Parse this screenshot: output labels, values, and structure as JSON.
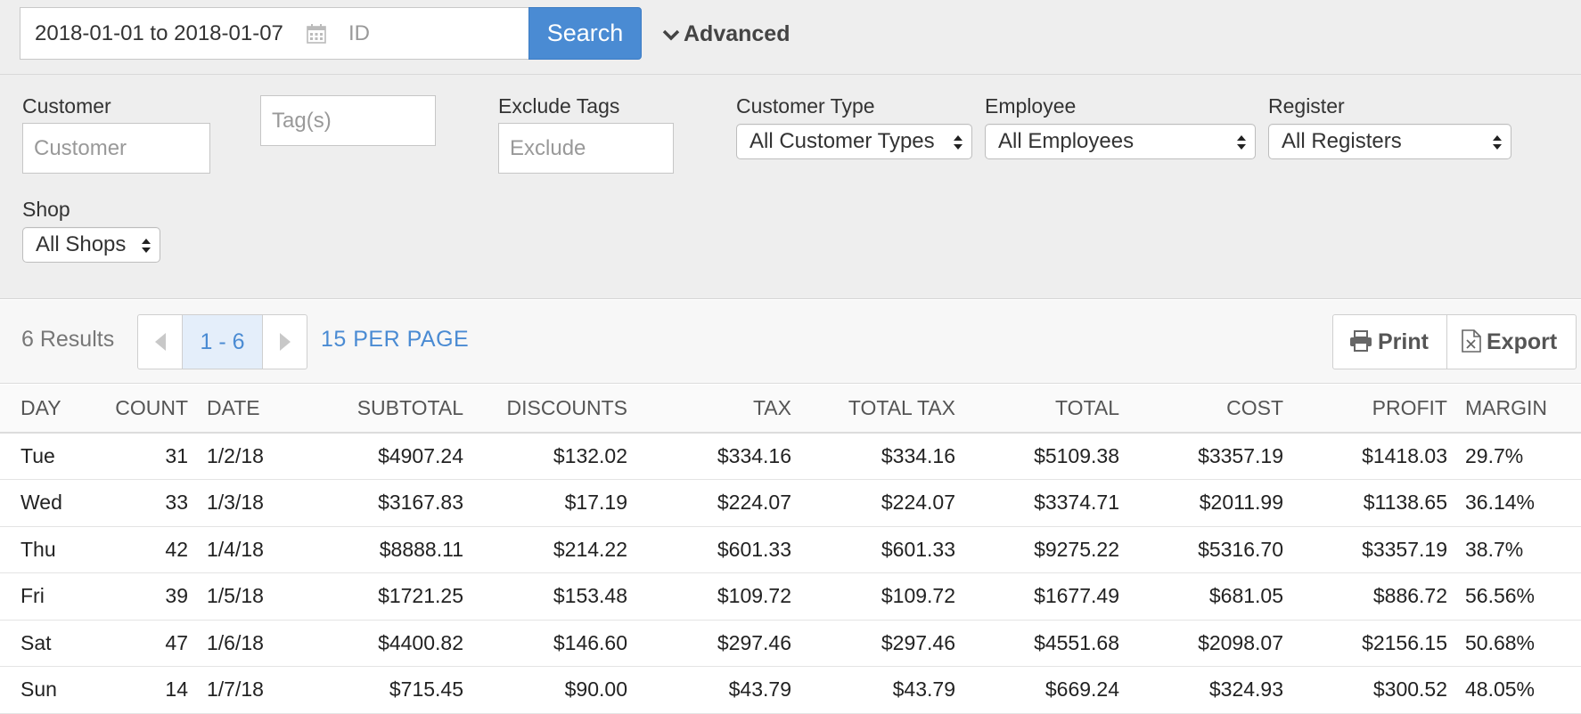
{
  "search": {
    "date_range": "2018-01-01 to 2018-01-07",
    "id_placeholder": "ID",
    "search_label": "Search",
    "advanced_label": "Advanced"
  },
  "filters": {
    "customer_label": "Customer",
    "customer_placeholder": "Customer",
    "tags_placeholder": "Tag(s)",
    "exclude_label": "Exclude Tags",
    "exclude_placeholder": "Exclude",
    "customer_type_label": "Customer Type",
    "customer_type_value": "All Customer Types",
    "employee_label": "Employee",
    "employee_value": "All Employees",
    "register_label": "Register",
    "register_value": "All Registers",
    "shop_label": "Shop",
    "shop_value": "All Shops"
  },
  "results": {
    "count_label": "6 Results",
    "page_range": "1 - 6",
    "per_page_label": "15 PER PAGE",
    "print_label": "Print",
    "export_label": "Export"
  },
  "table": {
    "headers": [
      "DAY",
      "COUNT",
      "DATE",
      "SUBTOTAL",
      "DISCOUNTS",
      "TAX",
      "TOTAL TAX",
      "TOTAL",
      "COST",
      "PROFIT",
      "MARGIN"
    ],
    "rows": [
      [
        "Tue",
        "31",
        "1/2/18",
        "$4907.24",
        "$132.02",
        "$334.16",
        "$334.16",
        "$5109.38",
        "$3357.19",
        "$1418.03",
        "29.7%"
      ],
      [
        "Wed",
        "33",
        "1/3/18",
        "$3167.83",
        "$17.19",
        "$224.07",
        "$224.07",
        "$3374.71",
        "$2011.99",
        "$1138.65",
        "36.14%"
      ],
      [
        "Thu",
        "42",
        "1/4/18",
        "$8888.11",
        "$214.22",
        "$601.33",
        "$601.33",
        "$9275.22",
        "$5316.70",
        "$3357.19",
        "38.7%"
      ],
      [
        "Fri",
        "39",
        "1/5/18",
        "$1721.25",
        "$153.48",
        "$109.72",
        "$109.72",
        "$1677.49",
        "$681.05",
        "$886.72",
        "56.56%"
      ],
      [
        "Sat",
        "47",
        "1/6/18",
        "$4400.82",
        "$146.60",
        "$297.46",
        "$297.46",
        "$4551.68",
        "$2098.07",
        "$2156.15",
        "50.68%"
      ],
      [
        "Sun",
        "14",
        "1/7/18",
        "$715.45",
        "$90.00",
        "$43.79",
        "$43.79",
        "$669.24",
        "$324.93",
        "$300.52",
        "48.05%"
      ]
    ]
  },
  "colors": {
    "accent": "#4a8bd3",
    "panel_bg": "#eeeeee"
  },
  "icons": {
    "date": "calendar-icon",
    "advanced": "chevron-down-icon",
    "print": "printer-icon",
    "export": "excel-file-icon"
  }
}
